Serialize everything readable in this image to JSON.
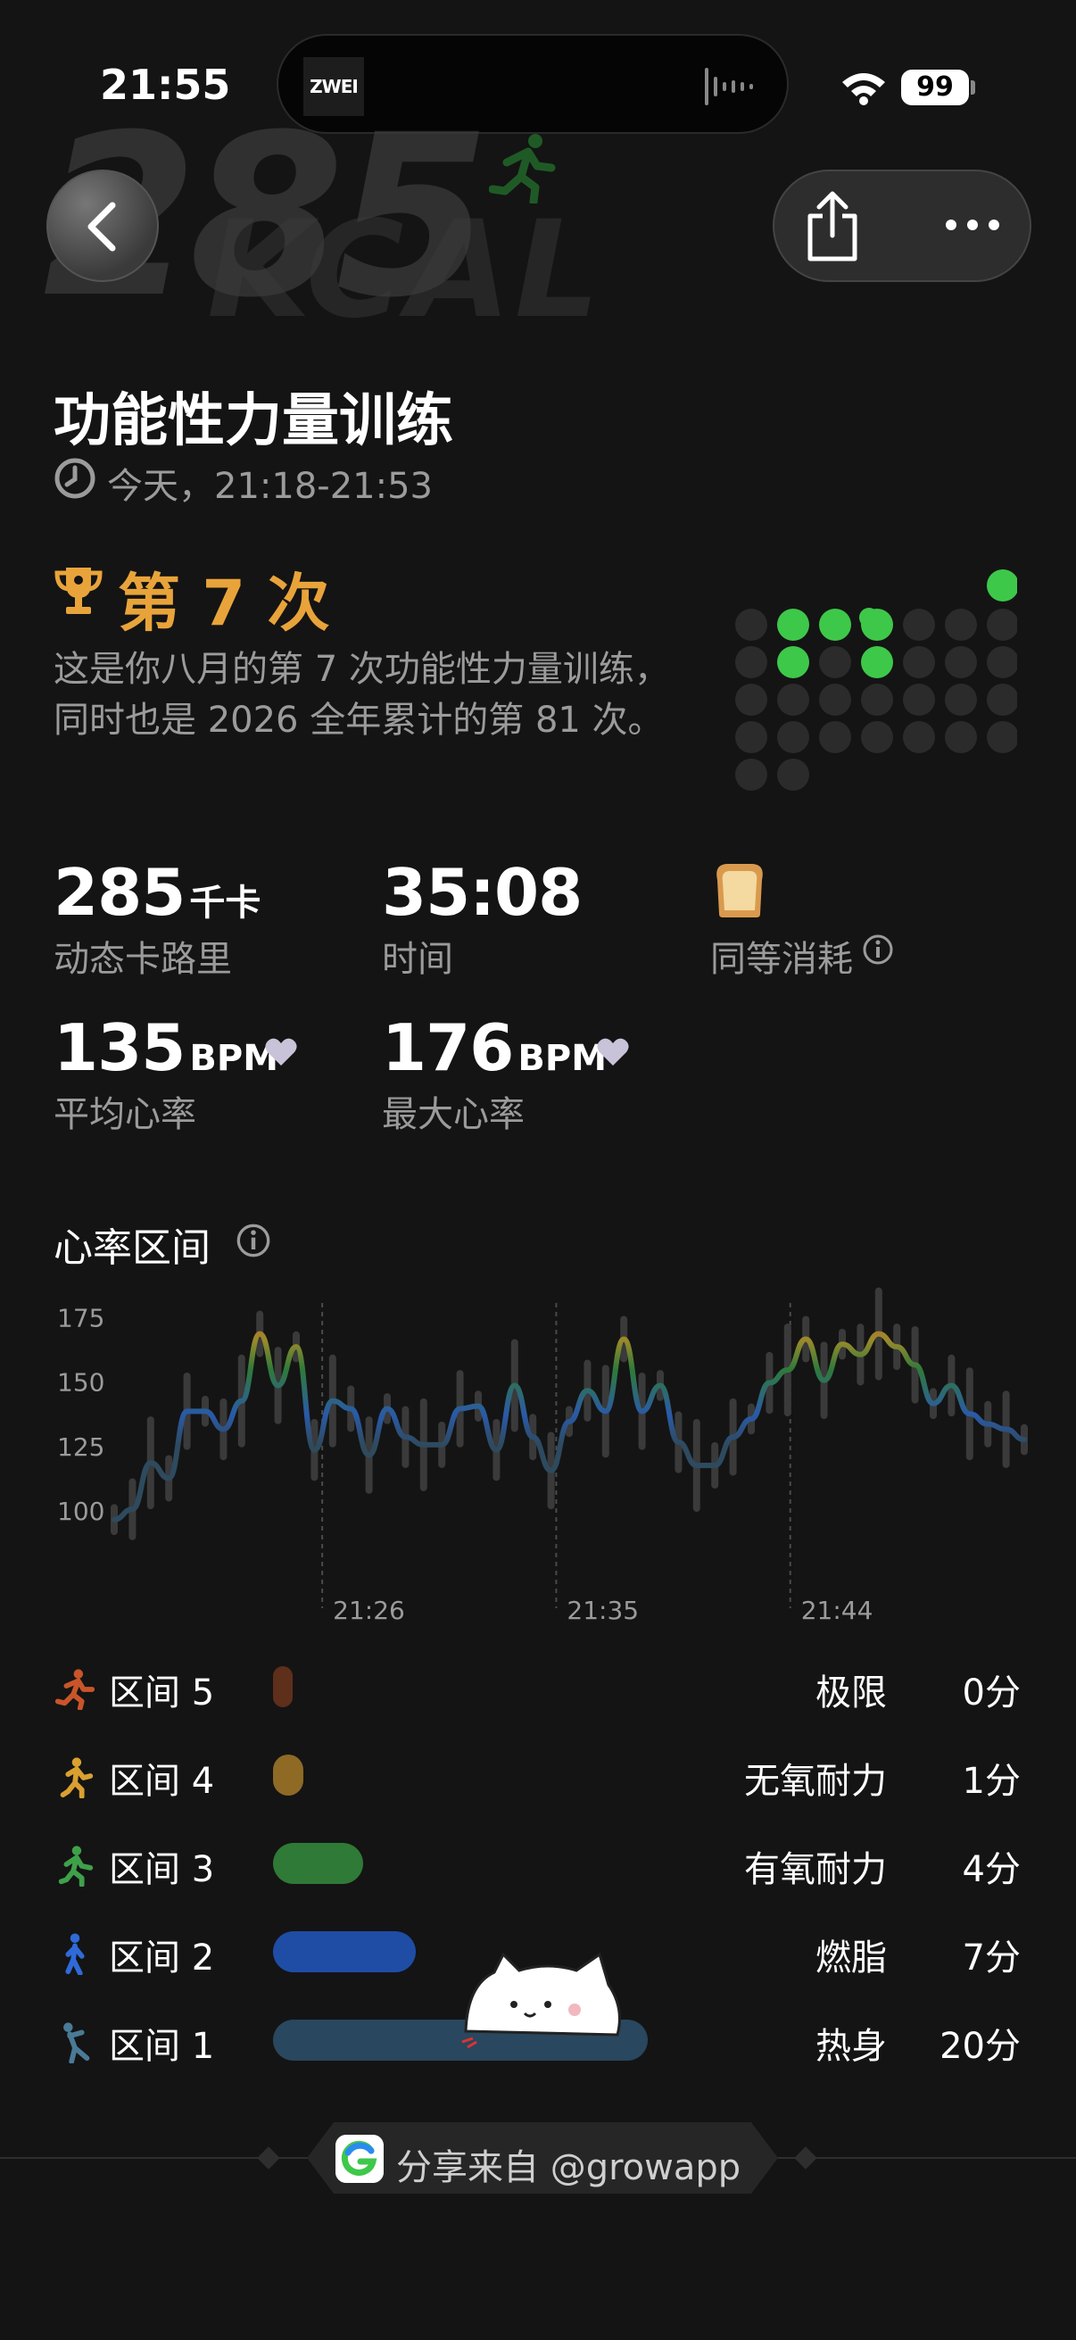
{
  "status_bar": {
    "time": "21:55",
    "island_logo": "ZWEI",
    "battery": "99"
  },
  "header": {
    "watermark_value": "285",
    "watermark_unit": "KCAL",
    "back_icon": "chevron-left-icon",
    "share_icon": "share-icon",
    "more_icon": "more-icon"
  },
  "workout": {
    "title": "功能性力量训练",
    "time_range": "今天，21:18-21:53"
  },
  "achievement": {
    "title": "第 7 次",
    "line1": "这是你八月的第 7 次功能性力量训练，",
    "line2": "同时也是 2026 全年累计的第 81 次。",
    "accent_color": "#e8a43a",
    "grid_active_color": "#3ec84a",
    "grid_inactive_color": "#2b2b2b"
  },
  "stats": {
    "calories": {
      "value": "285",
      "unit": "千卡",
      "label": "动态卡路里"
    },
    "duration": {
      "value": "35:08",
      "label": "时间"
    },
    "equivalent": {
      "icon": "bread-icon",
      "label": "同等消耗"
    },
    "avg_hr": {
      "value": "135",
      "unit": "BPM",
      "label": "平均心率"
    },
    "max_hr": {
      "value": "176",
      "unit": "BPM",
      "label": "最大心率"
    }
  },
  "hr_section": {
    "title": "心率区间"
  },
  "chart_data": {
    "type": "line",
    "title": "",
    "y_ticks": [
      "175",
      "150",
      "125",
      "100"
    ],
    "ylim": [
      90,
      180
    ],
    "x_tick_labels": [
      "21:26",
      "21:35",
      "21:44"
    ],
    "x_tick_minutes": [
      8,
      17,
      26
    ],
    "xlim": [
      0,
      35
    ],
    "series": [
      {
        "minutes": [
          0,
          0.7,
          1.4,
          2.1,
          2.8,
          3.5,
          4.2,
          4.9,
          5.6,
          6.3,
          7.0,
          7.7,
          8.4,
          9.1,
          9.8,
          10.5,
          11.2,
          11.9,
          12.6,
          13.3,
          14.0,
          14.7,
          15.4,
          16.1,
          16.8,
          17.5,
          18.2,
          18.9,
          19.6,
          20.3,
          21.0,
          21.7,
          22.4,
          23.1,
          23.8,
          24.5,
          25.2,
          25.9,
          26.6,
          27.3,
          28.0,
          28.7,
          29.4,
          30.1,
          30.8,
          31.5,
          32.2,
          32.9,
          33.6,
          34.3,
          35.0
        ],
        "bpm": [
          96,
          100,
          118,
          112,
          138,
          138,
          131,
          142,
          168,
          148,
          163,
          123,
          142,
          139,
          121,
          139,
          128,
          125,
          125,
          139,
          140,
          123,
          148,
          128,
          115,
          134,
          146,
          138,
          166,
          138,
          148,
          126,
          117,
          117,
          128,
          135,
          149,
          154,
          166,
          150,
          164,
          160,
          168,
          163,
          156,
          141,
          148,
          137,
          133,
          131,
          127
        ]
      }
    ],
    "bpm_range_bars": true,
    "grid": "vertical dashed at x ticks"
  },
  "zones": [
    {
      "icon": "zone5-runner-icon",
      "label": "区间 5",
      "name": "极限",
      "minutes": "0分",
      "fraction": 0.05,
      "color": "#5e2f1a"
    },
    {
      "icon": "zone4-runner-icon",
      "label": "区间 4",
      "name": "无氧耐力",
      "minutes": "1分",
      "fraction": 0.08,
      "color": "#8e6a25"
    },
    {
      "icon": "zone3-runner-icon",
      "label": "区间 3",
      "name": "有氧耐力",
      "minutes": "4分",
      "fraction": 0.24,
      "color": "#2e7a36"
    },
    {
      "icon": "zone2-walker-icon",
      "label": "区间 2",
      "name": "燃脂",
      "minutes": "7分",
      "fraction": 0.38,
      "color": "#1f4da6"
    },
    {
      "icon": "zone1-stretch-icon",
      "label": "区间 1",
      "name": "热身",
      "minutes": "20分",
      "fraction": 1.0,
      "color": "#29475e"
    }
  ],
  "footer": {
    "text": "分享来自 @growapp",
    "logo_icon": "grow-logo-icon"
  }
}
